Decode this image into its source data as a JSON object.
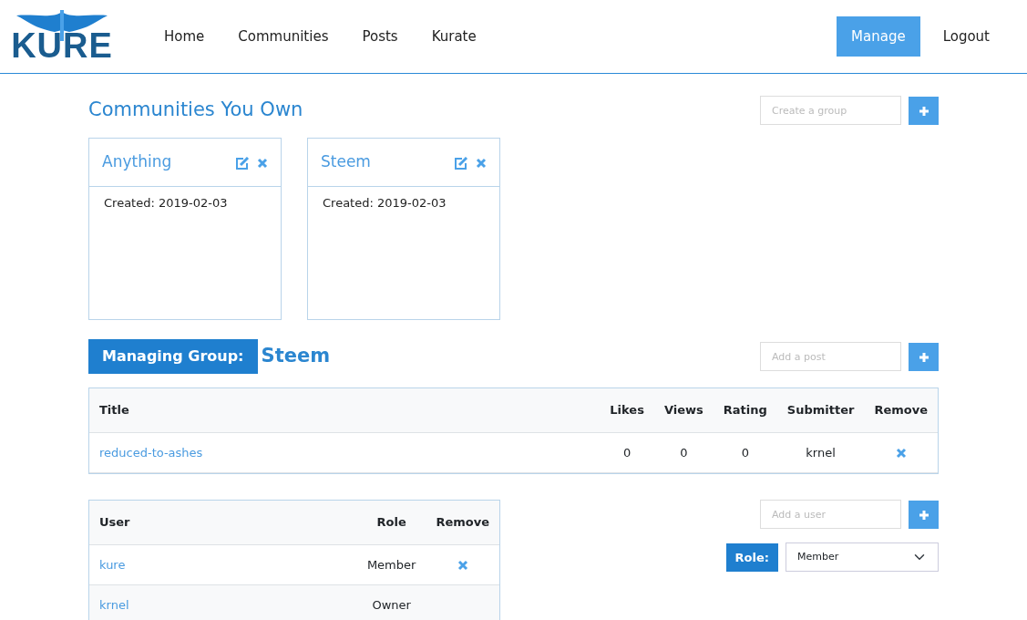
{
  "logo": {
    "text": "KURE"
  },
  "nav": {
    "links": [
      {
        "label": "Home",
        "selected": false
      },
      {
        "label": "Communities",
        "selected": false
      },
      {
        "label": "Posts",
        "selected": false
      },
      {
        "label": "Kurate",
        "selected": false
      }
    ],
    "right": [
      {
        "label": "Manage",
        "selected": true
      },
      {
        "label": "Logout",
        "selected": false
      }
    ]
  },
  "owned": {
    "title": "Communities You Own",
    "create": {
      "placeholder": "Create a group"
    },
    "groups": [
      {
        "name": "Anything",
        "created": "Created: 2019-02-03"
      },
      {
        "name": "Steem",
        "created": "Created: 2019-02-03"
      }
    ]
  },
  "managing": {
    "label": "Managing Group:",
    "group": "Steem",
    "add_post": {
      "placeholder": "Add a post"
    }
  },
  "posts": {
    "columns": [
      "Title",
      "Likes",
      "Views",
      "Rating",
      "Submitter",
      "Remove"
    ],
    "rows": [
      {
        "title": "reduced-to-ashes",
        "likes": "0",
        "views": "0",
        "rating": "0",
        "submitter": "krnel",
        "removable": true
      }
    ]
  },
  "users": {
    "columns": [
      "User",
      "Role",
      "Remove"
    ],
    "rows": [
      {
        "user": "kure",
        "role": "Member",
        "removable": true
      },
      {
        "user": "krnel",
        "role": "Owner",
        "removable": false
      }
    ]
  },
  "add_user": {
    "placeholder": "Add a user",
    "role_label": "Role:",
    "role_value": "Member"
  }
}
